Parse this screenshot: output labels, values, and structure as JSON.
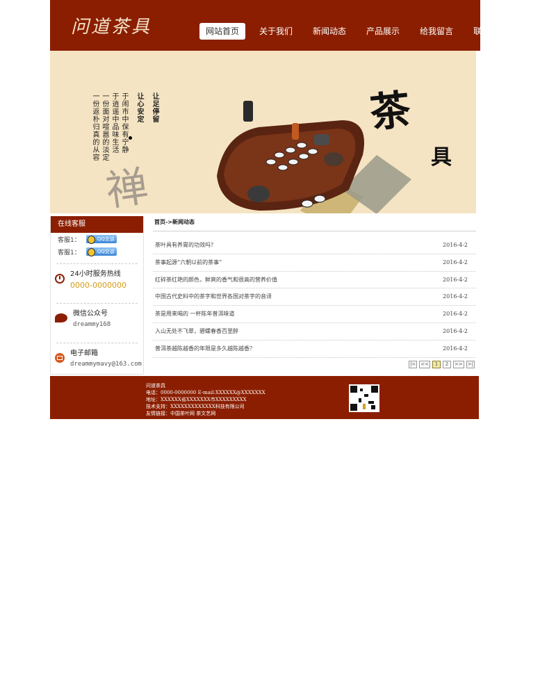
{
  "header": {
    "logo": "问道茶具",
    "nav": [
      "网站首页",
      "关于我们",
      "新闻动态",
      "产品展示",
      "给我留言",
      "联系我们"
    ],
    "active_index": 0
  },
  "banner": {
    "heading_col1": "让足停留",
    "heading_col2": "让心安定",
    "poem_cols": [
      "于闹市中保有宁静",
      "于逍遥中品味生活",
      "一份面对喧嚣的淡定",
      "一份返朴归真的从容"
    ],
    "brush_char": "禅",
    "big_title": "茶",
    "big_sub": "具"
  },
  "sidebar": {
    "title": "在线客服",
    "qq_label": "客服1：",
    "qq_badge": "QQ交谈",
    "hotline_title": "24小时服务热线",
    "hotline_number": "0000-0000000",
    "wechat_title": "微信公众号",
    "wechat_id": "dreammy168",
    "email_title": "电子邮箱",
    "email": "dreammymavy@163.com"
  },
  "main": {
    "breadcrumb": "首页->新闻动态",
    "news": [
      {
        "title": "茶叶具有养胃的功效吗？",
        "date": "2016-4-2"
      },
      {
        "title": "茶事起源“六朝以前的茶事”",
        "date": "2016-4-2"
      },
      {
        "title": "红碎茶红艳的颜色，鲜爽的香气和很高的营养价值",
        "date": "2016-4-2"
      },
      {
        "title": "中国古代史料中的茶字和世界各国对茶字的音译",
        "date": "2016-4-2"
      },
      {
        "title": "茶是用来喝的 一杯陈年普洱味道",
        "date": "2016-4-2"
      },
      {
        "title": "入山无处不飞翠，碧螺春香百里醉",
        "date": "2016-4-2"
      },
      {
        "title": "普洱茶越陈越香的年限是多久越陈越香？",
        "date": "2016-4-2"
      }
    ],
    "pager": [
      "|<",
      "<<",
      "1",
      "2",
      ">>",
      ">|"
    ],
    "current_page": "1"
  },
  "footer": {
    "line1": "问道茶具",
    "line2": "电话：0000-0000000   E-mail:XXXXXX@XXXXXXX",
    "line3": "地址：XXXXXX省XXXXXXX市XXXXXXXXX",
    "line4": "技术支持：XXXXXXXXXXXXX科技有限公司",
    "line5": "友情链接：中国茶叶网   茶文艺网"
  },
  "colors": {
    "brand": "#8b1e00",
    "banner_bg": "#f5e4c3",
    "hotline": "#d49a12"
  }
}
